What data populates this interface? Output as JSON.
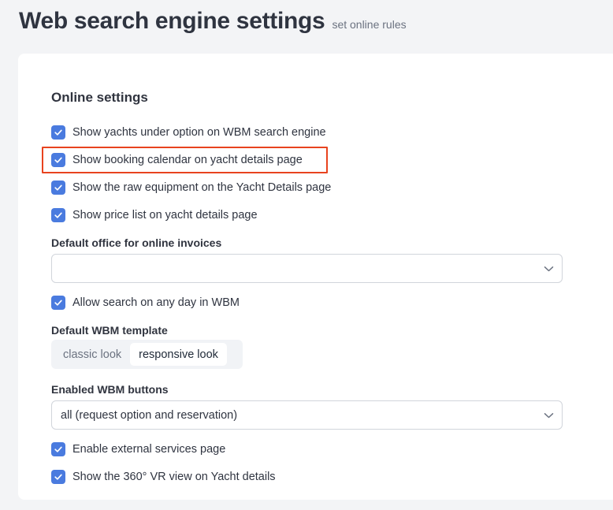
{
  "header": {
    "title": "Web search engine settings",
    "subtitle": "set online rules"
  },
  "online_settings": {
    "title": "Online settings",
    "checks": [
      {
        "label": "Show yachts under option on WBM search engine",
        "checked": true
      },
      {
        "label": "Show booking calendar on yacht details page",
        "checked": true
      },
      {
        "label": "Show the raw equipment on the Yacht Details page",
        "checked": true
      },
      {
        "label": "Show price list on yacht details page",
        "checked": true
      }
    ],
    "default_office": {
      "label": "Default office for online invoices",
      "value": ""
    },
    "allow_search": {
      "label": "Allow search on any day in WBM",
      "checked": true
    },
    "template": {
      "label": "Default WBM template",
      "options": [
        "classic look",
        "responsive look"
      ],
      "selected": "responsive look"
    },
    "buttons": {
      "label": "Enabled WBM buttons",
      "value": "all (request option and reservation)"
    },
    "external_services": {
      "label": "Enable external services page",
      "checked": true
    },
    "vr_view": {
      "label": "Show the 360° VR view on Yacht details",
      "checked": true
    }
  },
  "colors": {
    "checkbox": "#4a7bdf",
    "highlight": "#e8431f"
  }
}
